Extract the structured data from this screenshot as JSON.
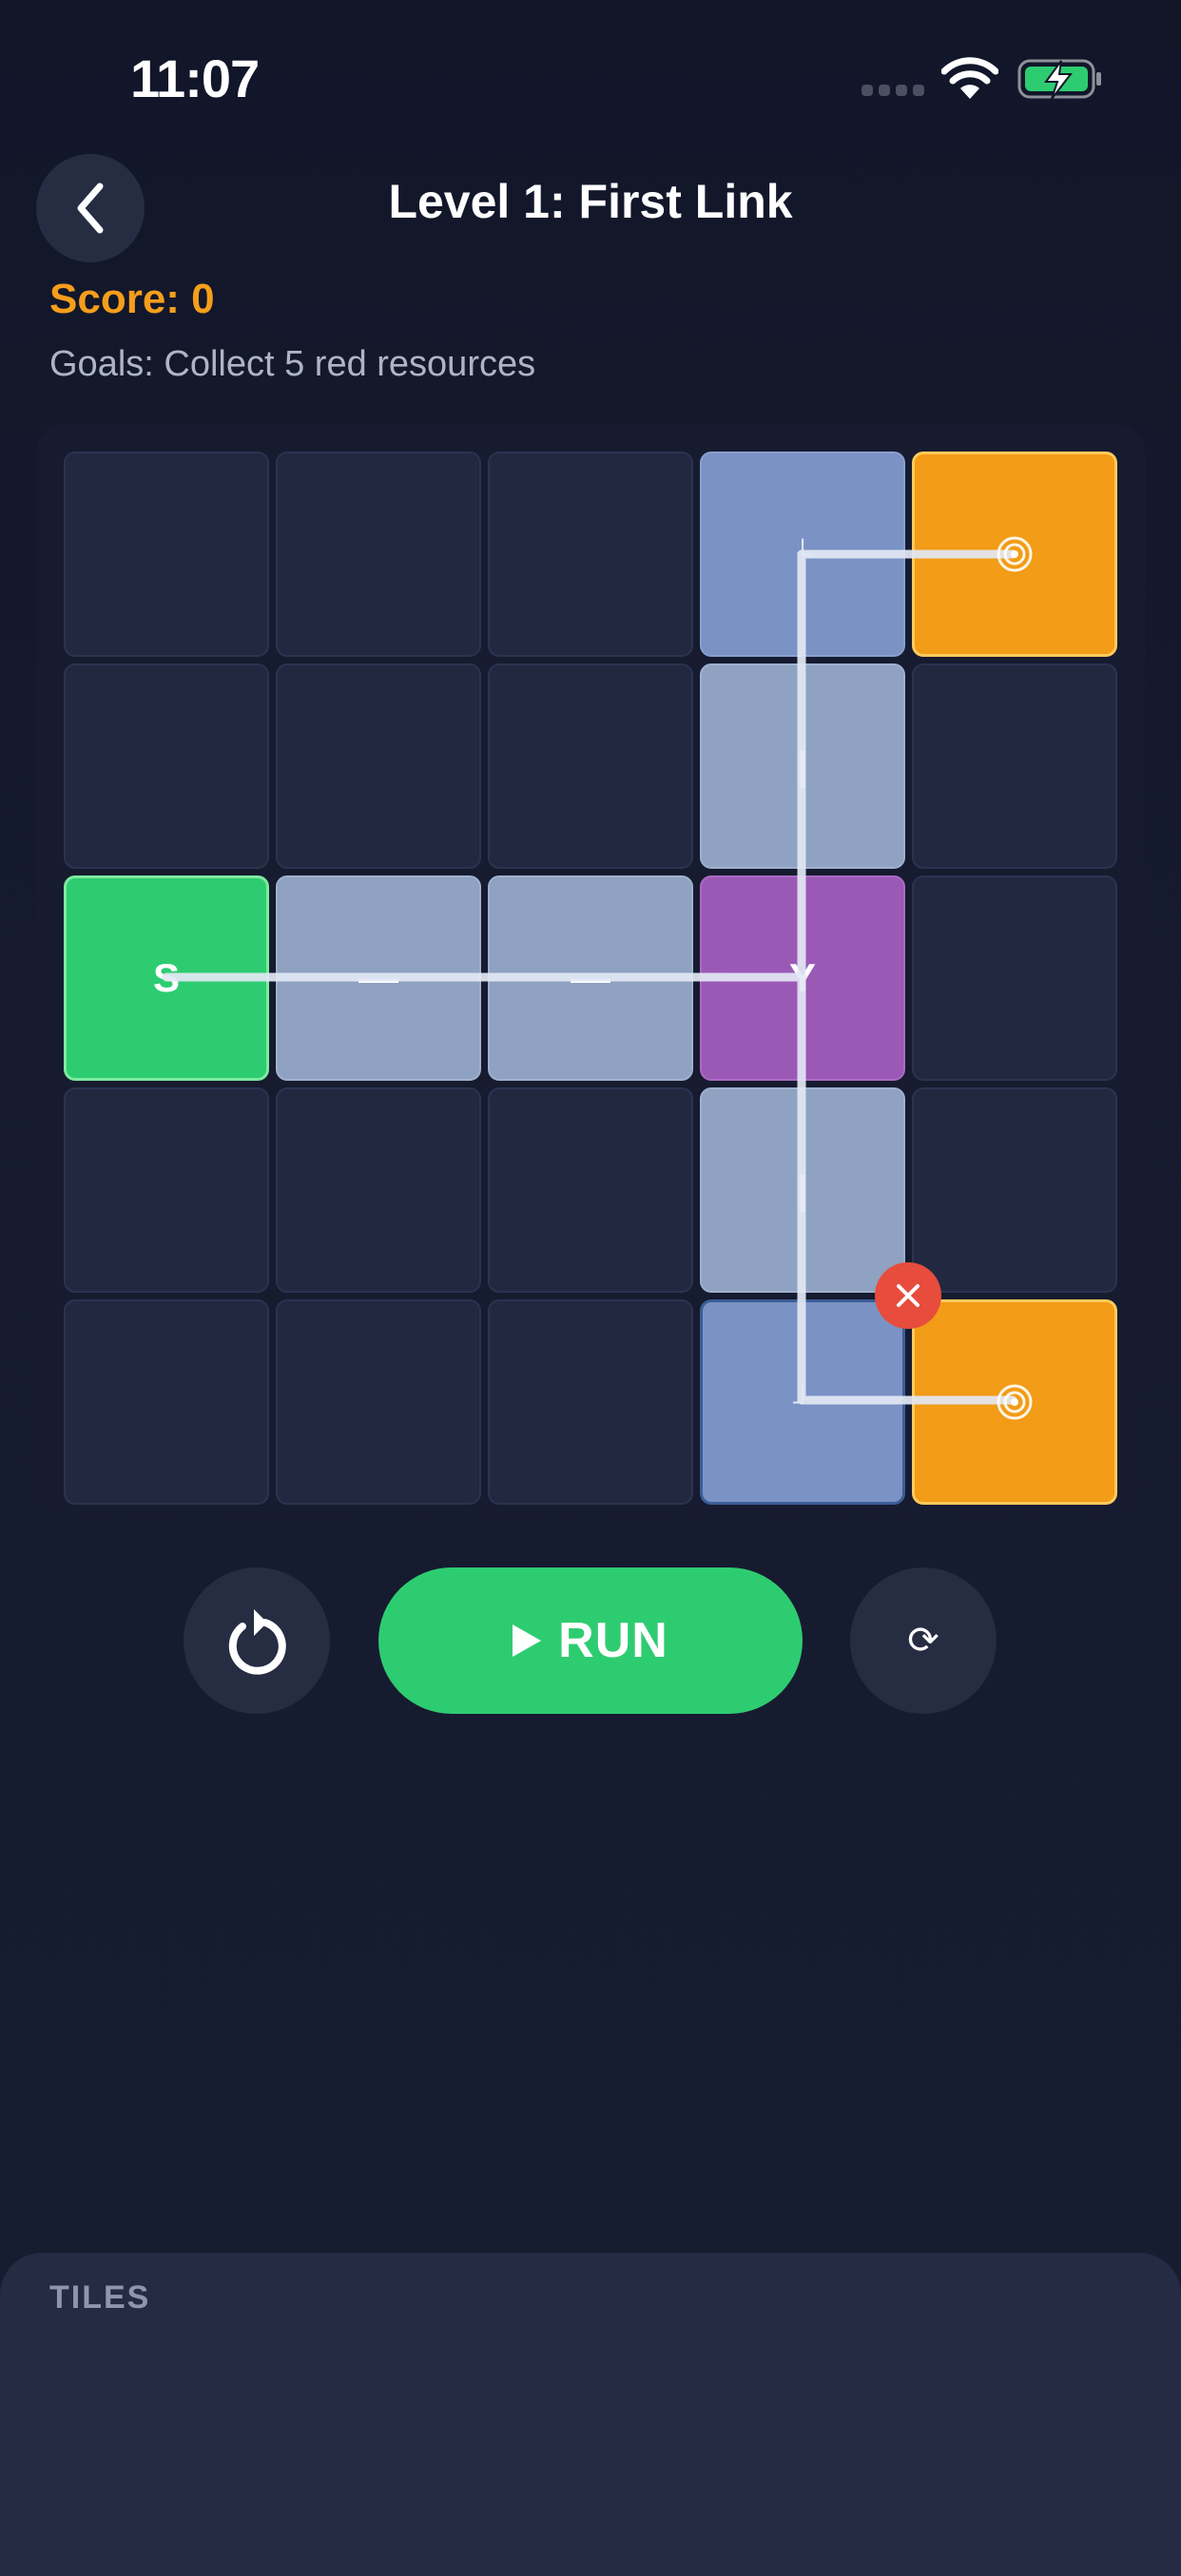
{
  "status_bar": {
    "time": "11:07"
  },
  "header": {
    "title": "Level 1: First Link",
    "back_icon": "chevron-left-icon"
  },
  "score_text": "Score: 0",
  "goals_text": "Goals: Collect 5 red resources",
  "board": {
    "rows": 5,
    "cols": 5,
    "tiles": [
      {
        "row": 0,
        "col": 3,
        "kind": "corner",
        "label": "└"
      },
      {
        "row": 0,
        "col": 4,
        "kind": "target",
        "label": ""
      },
      {
        "row": 1,
        "col": 3,
        "kind": "straight-vertical",
        "label": "|"
      },
      {
        "row": 2,
        "col": 0,
        "kind": "start",
        "label": "S"
      },
      {
        "row": 2,
        "col": 1,
        "kind": "straight-horizontal",
        "label": "—"
      },
      {
        "row": 2,
        "col": 2,
        "kind": "straight-horizontal",
        "label": "—"
      },
      {
        "row": 2,
        "col": 3,
        "kind": "split",
        "label": "Y"
      },
      {
        "row": 3,
        "col": 3,
        "kind": "straight-vertical",
        "label": "|"
      },
      {
        "row": 4,
        "col": 3,
        "kind": "corner",
        "label": "┘",
        "selected": true
      },
      {
        "row": 4,
        "col": 4,
        "kind": "target",
        "label": ""
      }
    ]
  },
  "controls": {
    "undo_icon": "undo-icon",
    "run_label": "RUN",
    "run_icon": "play-icon",
    "rotate_glyph": "⟳",
    "remove_icon": "close-icon"
  },
  "tray": {
    "title": "TILES"
  },
  "colors": {
    "background": "#121629",
    "score": "#f59e1b",
    "start": "#2ecc71",
    "target": "#f29c17",
    "split": "#9b59b6",
    "tile": "#8fa2c1",
    "corner": "#7a92c4",
    "remove": "#e74c3c",
    "run": "#2ecc71"
  }
}
